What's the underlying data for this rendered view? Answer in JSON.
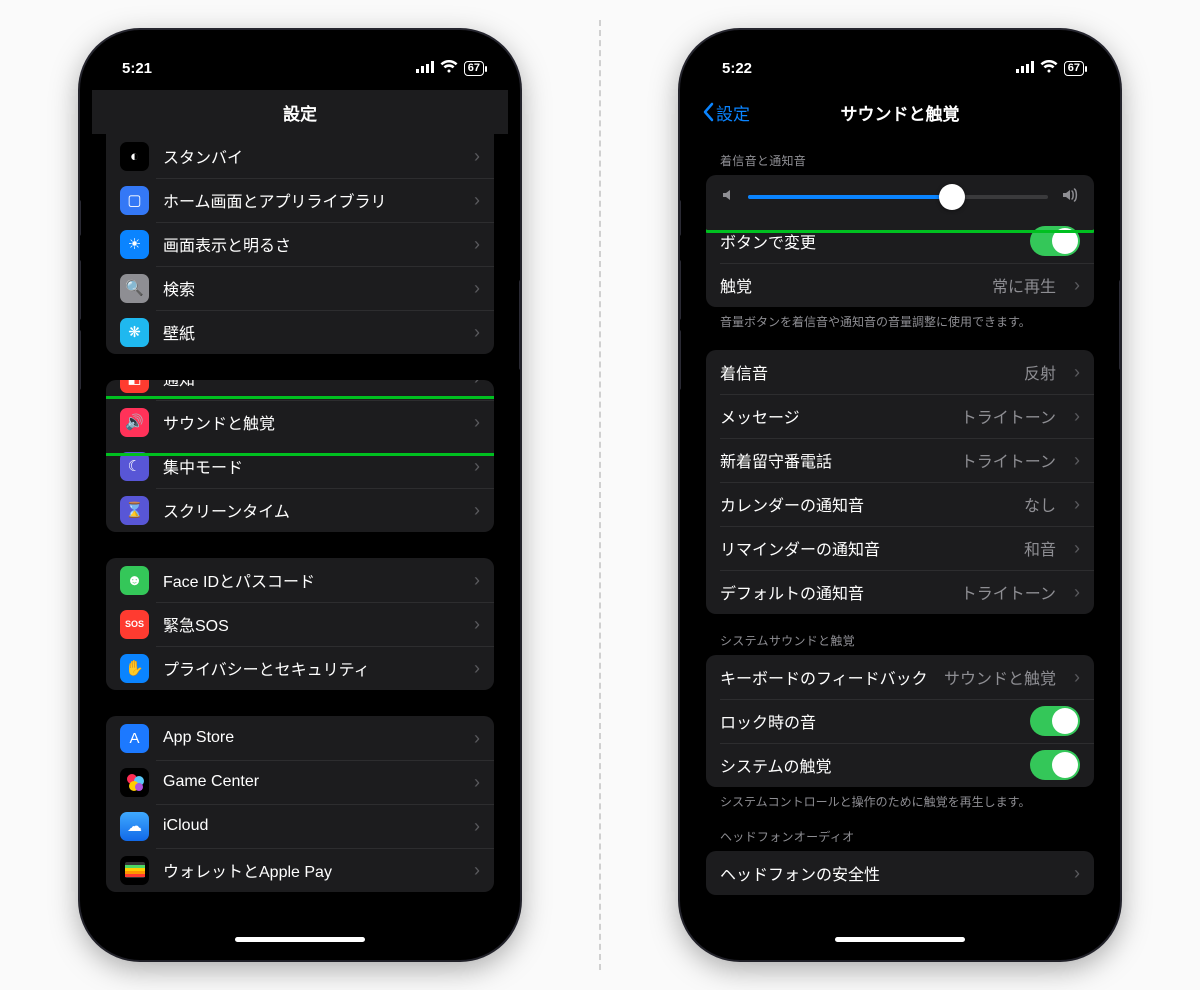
{
  "left": {
    "time": "5:21",
    "battery": "67",
    "title": "設定",
    "groups": [
      {
        "cutoff": true,
        "items": [
          {
            "icon_bg": "#000",
            "glyph": "◐",
            "label": "スタンバイ"
          },
          {
            "icon_bg": "#3478f6",
            "glyph": "▢",
            "label": "ホーム画面とアプリライブラリ"
          },
          {
            "icon_bg": "#0a84ff",
            "glyph": "☀",
            "label": "画面表示と明るさ"
          },
          {
            "icon_bg": "#8e8e93",
            "glyph": "🔍",
            "label": "検索"
          },
          {
            "icon_bg": "#1fb8ef",
            "glyph": "❋",
            "label": "壁紙"
          }
        ]
      },
      {
        "items": [
          {
            "icon_bg": "#ff3b30",
            "glyph": "◧",
            "label": "通知",
            "partial": true
          },
          {
            "icon_bg": "#ff3259",
            "glyph": "🔊",
            "label": "サウンドと触覚",
            "highlight": true
          },
          {
            "icon_bg": "#5856d6",
            "glyph": "☾",
            "label": "集中モード"
          },
          {
            "icon_bg": "#5856d6",
            "glyph": "⌛",
            "label": "スクリーンタイム"
          }
        ]
      },
      {
        "items": [
          {
            "icon_bg": "#34c759",
            "glyph": "☻",
            "label": "Face IDとパスコード"
          },
          {
            "icon_bg": "#ff3b30",
            "glyph": "SOS",
            "label": "緊急SOS",
            "small_text": true
          },
          {
            "icon_bg": "#0a84ff",
            "glyph": "✋",
            "label": "プライバシーとセキュリティ"
          }
        ]
      },
      {
        "items": [
          {
            "icon_bg": "#1c79ff",
            "glyph": "A",
            "label": "App Store"
          },
          {
            "icon_bg": "#000",
            "glyph": "●",
            "bubble": "gc",
            "label": "Game Center"
          },
          {
            "icon_bg": "linear-gradient(#3fa9ff,#1169e8)",
            "glyph": "☁",
            "label": "iCloud"
          },
          {
            "icon_bg": "#000",
            "glyph": "▭",
            "wallet": true,
            "label": "ウォレットとApple Pay"
          }
        ]
      }
    ]
  },
  "right": {
    "time": "5:22",
    "battery": "67",
    "back": "設定",
    "title": "サウンドと触覚",
    "ringer_header": "着信音と通知音",
    "slider_percent": 68,
    "change_with_buttons": {
      "label": "ボタンで変更",
      "on": true
    },
    "haptics_row": {
      "label": "触覚",
      "value": "常に再生"
    },
    "ringer_footer": "音量ボタンを着信音や通知音の音量調整に使用できます。",
    "sounds_group": [
      {
        "label": "着信音",
        "value": "反射"
      },
      {
        "label": "メッセージ",
        "value": "トライトーン"
      },
      {
        "label": "新着留守番電話",
        "value": "トライトーン"
      },
      {
        "label": "カレンダーの通知音",
        "value": "なし"
      },
      {
        "label": "リマインダーの通知音",
        "value": "和音"
      },
      {
        "label": "デフォルトの通知音",
        "value": "トライトーン"
      }
    ],
    "system_header": "システムサウンドと触覚",
    "keyboard_row": {
      "label": "キーボードのフィードバック",
      "value": "サウンドと触覚"
    },
    "lock_row": {
      "label": "ロック時の音",
      "on": true
    },
    "sys_haptics_row": {
      "label": "システムの触覚",
      "on": true
    },
    "system_footer": "システムコントロールと操作のために触覚を再生します。",
    "headphone_header": "ヘッドフォンオーディオ",
    "headphone_safety": "ヘッドフォンの安全性"
  }
}
